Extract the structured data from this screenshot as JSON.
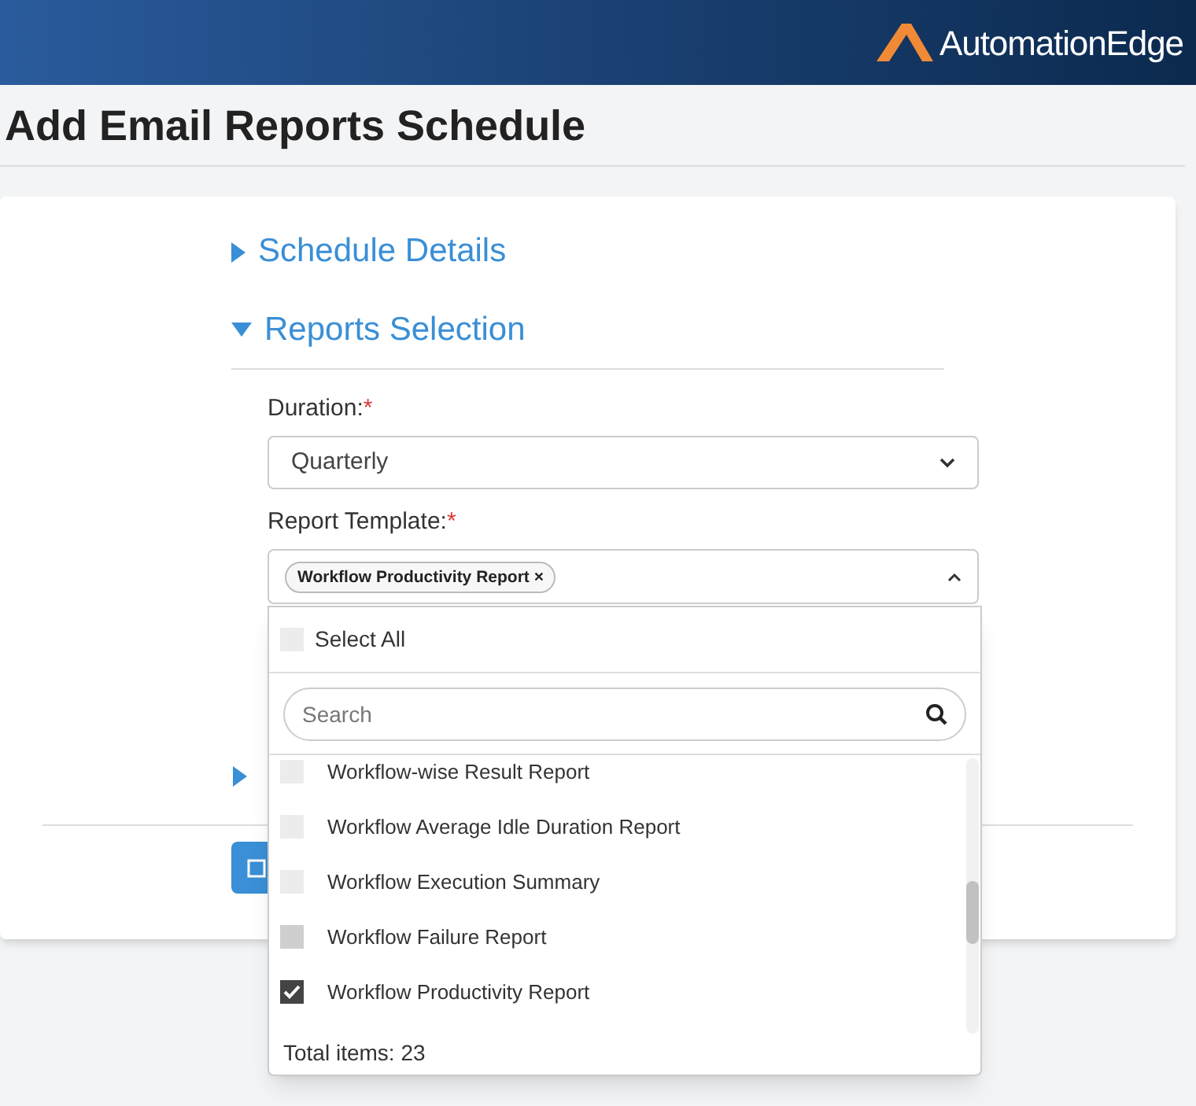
{
  "header": {
    "logo_text": "AutomationEdge"
  },
  "page_title": "Add Email Reports Schedule",
  "sections": [
    {
      "title": "Schedule Details",
      "expanded": false
    },
    {
      "title": "Reports Selection",
      "expanded": true
    }
  ],
  "form": {
    "duration_label": "Duration:",
    "duration_required": "*",
    "duration_value": "Quarterly",
    "template_label": "Report Template:",
    "template_required": "*",
    "chips": [
      {
        "label": "Workflow Productivity Report",
        "remove": "×"
      }
    ]
  },
  "dropdown": {
    "select_all": {
      "label": "Select All",
      "checked": false
    },
    "search": {
      "placeholder": "Search"
    },
    "options": [
      {
        "label": "Workflow-wise Result Report",
        "checked": false,
        "hovered": false
      },
      {
        "label": "Workflow Average Idle Duration Report",
        "checked": false,
        "hovered": false
      },
      {
        "label": "Workflow Execution Summary",
        "checked": false,
        "hovered": false
      },
      {
        "label": "Workflow Failure Report",
        "checked": false,
        "hovered": true
      },
      {
        "label": "Workflow Productivity Report",
        "checked": true,
        "hovered": false
      }
    ],
    "total": "Total items: 23"
  },
  "hidden_section": {
    "expanded": false
  }
}
